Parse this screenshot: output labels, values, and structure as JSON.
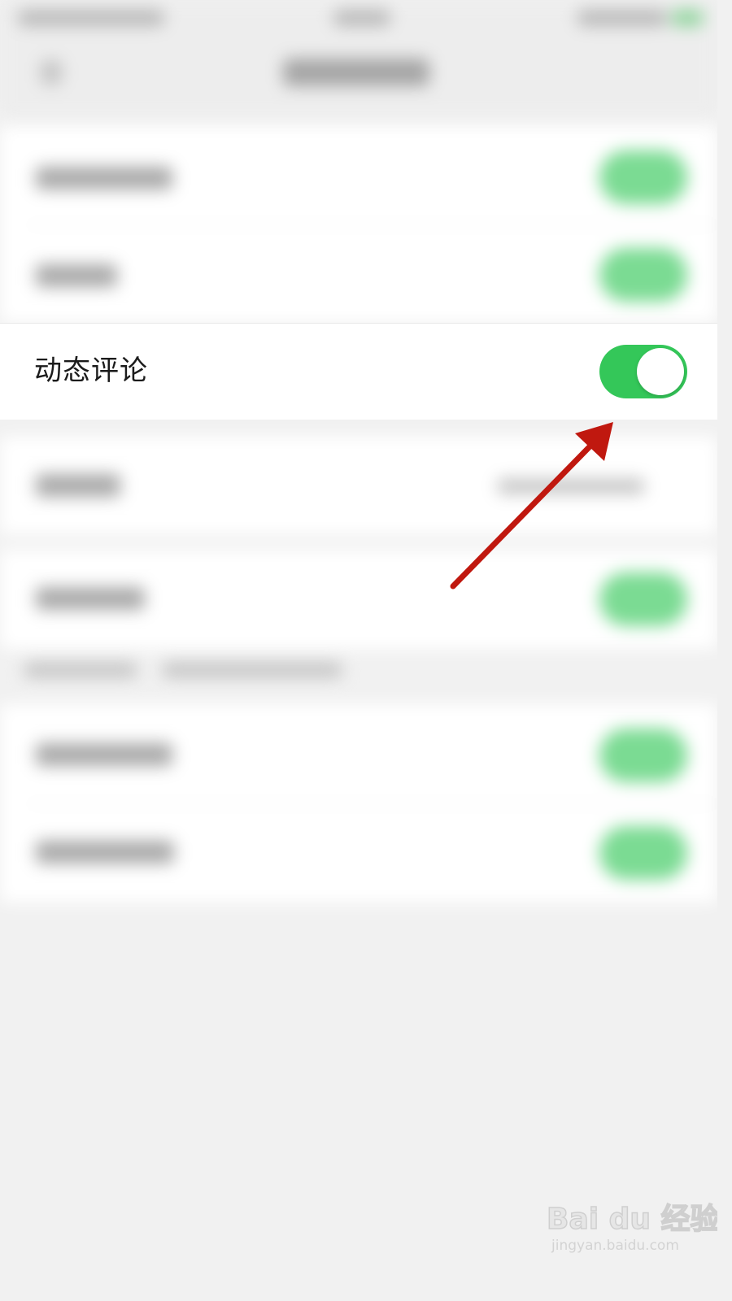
{
  "settings_row": {
    "label": "动态评论",
    "toggle_on": true
  },
  "colors": {
    "toggle_on": "#34c759",
    "arrow": "#c0180f",
    "background": "#f1f1f1"
  },
  "watermark": {
    "logo": "Bai du 经验",
    "url": "jingyan.baidu.com"
  }
}
